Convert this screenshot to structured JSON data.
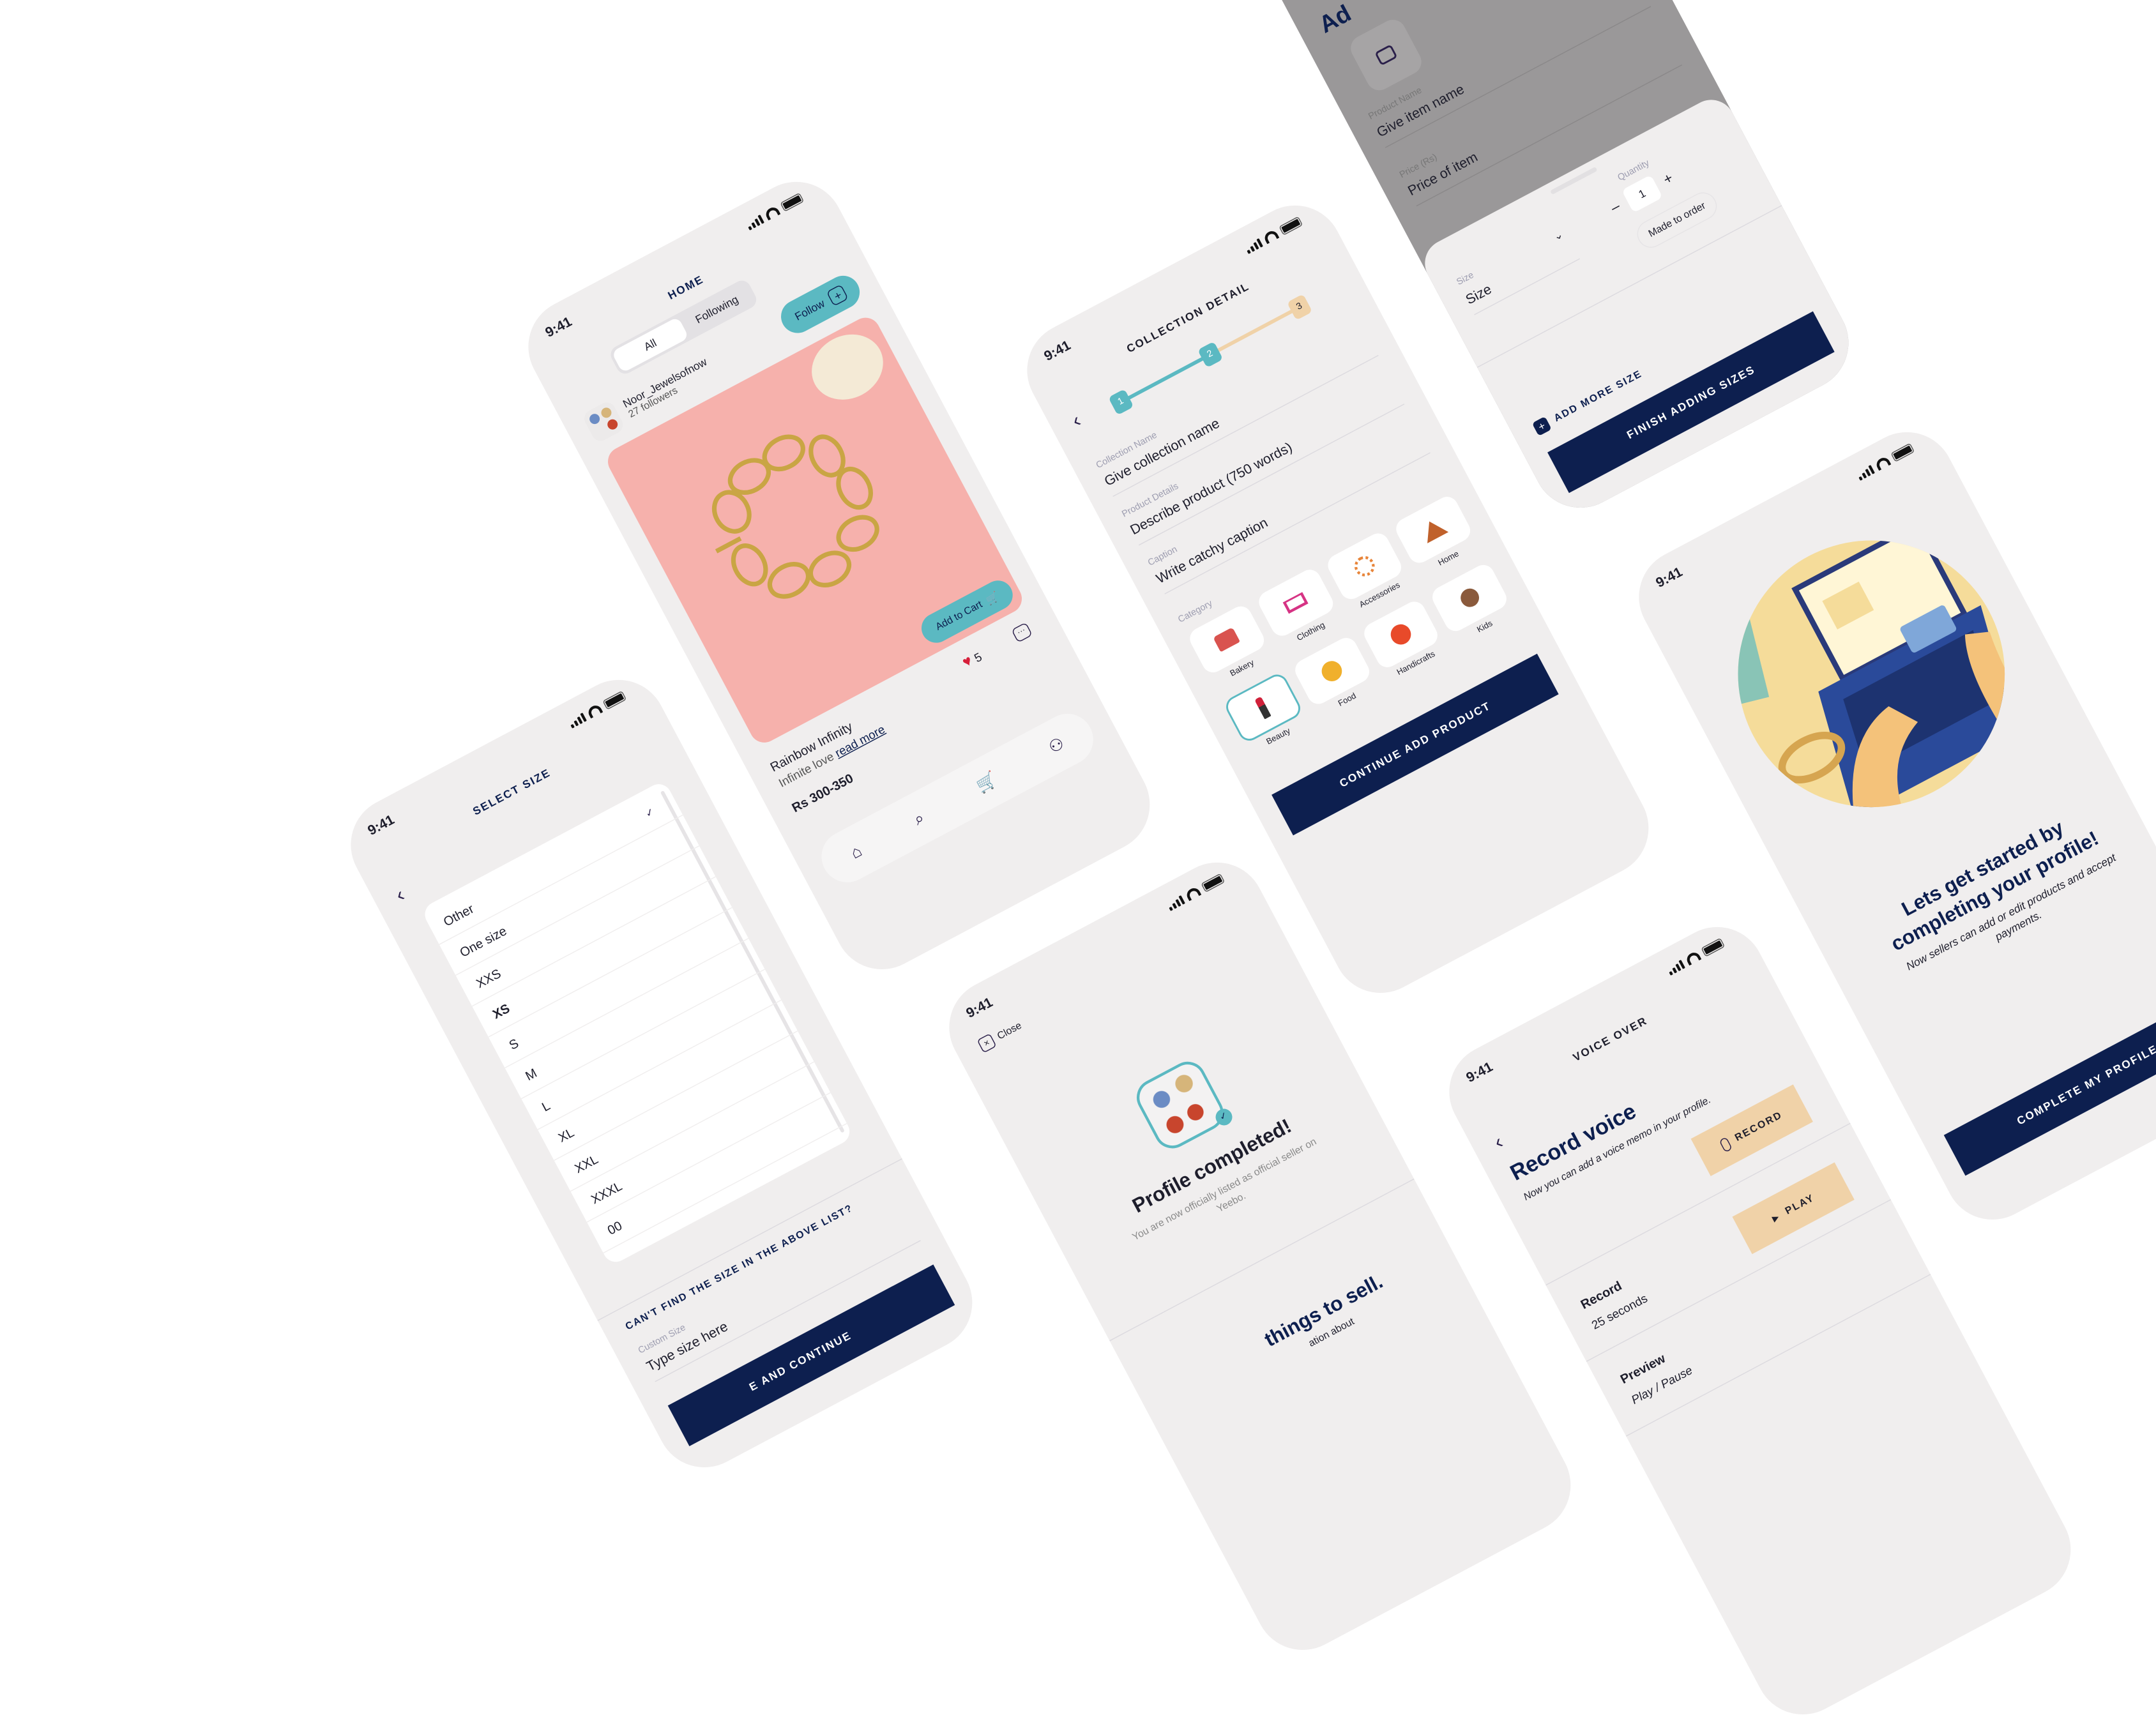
{
  "status": {
    "time": "9:41"
  },
  "colors": {
    "navy": "#0d1f4f",
    "teal": "#5bb9c2",
    "peach": "#f0d2a8",
    "screen_bg": "#f0eeee",
    "pink": "#f6b1ac"
  },
  "home": {
    "title": "HOME",
    "tabs": [
      {
        "label": "All",
        "active": true
      },
      {
        "label": "Following",
        "active": false
      }
    ],
    "follow_label": "Follow",
    "seller": {
      "name": "Noor_Jewelsofnow",
      "followers": "27 followers"
    },
    "product": {
      "name": "Rainbow Infinity",
      "desc": "Infinite love",
      "read_more": "read more",
      "price": "Rs 300-350",
      "likes": "5"
    },
    "add_to_cart": "Add to Cart",
    "nav": [
      "home-icon",
      "search-icon",
      "cart-icon",
      "profile-icon"
    ]
  },
  "collection": {
    "title": "COLLECTION DETAIL",
    "steps": [
      "1",
      "2",
      "3"
    ],
    "current_step": 2,
    "fields": [
      {
        "label": "Collection Name",
        "placeholder": "Give collection name"
      },
      {
        "label": "Product Details",
        "placeholder": "Describe product (750 words)"
      },
      {
        "label": "Caption",
        "placeholder": "Write catchy caption"
      }
    ],
    "category_label": "Category",
    "categories": [
      "Bakery",
      "Clothing",
      "Accessories",
      "Home",
      "Beauty",
      "Food",
      "Handicrafts",
      "Kids"
    ],
    "selected_category": "Beauty",
    "continue_label": "CONTINUE ADD PRODUCT"
  },
  "add_item": {
    "title": "Ad",
    "product_name_label": "Product Name",
    "product_name_placeholder": "Give item name",
    "price_label": "Price (Rs)",
    "price_placeholder": "Price of item",
    "size_label": "Size",
    "size_value": "Size",
    "quantity_label": "Quantity",
    "quantity_value": "1",
    "minus": "–",
    "plus": "+",
    "made_to_order": "Made to order",
    "add_more_size": "ADD MORE SIZE",
    "finish_label": "FINISH ADDING SIZES"
  },
  "select_size": {
    "title": "SELECT SIZE",
    "options": [
      "Other",
      "One size",
      "XXS",
      "XS",
      "S",
      "M",
      "L",
      "XL",
      "XXL",
      "XXXL",
      "00"
    ],
    "checked": "Other",
    "bold": "XS",
    "cant_find": "CAN'T FIND THE SIZE IN THE ABOVE LIST?",
    "custom_label": "Custom Size",
    "custom_placeholder": "Type size here",
    "continue_label": "E AND CONTINUE"
  },
  "profile_done": {
    "close_label": "Close",
    "heading": "Profile completed!",
    "message": "You are now officially listed as official seller on Yeebo.",
    "next_heading": "things to sell.",
    "next_text": "ation about"
  },
  "voice": {
    "title": "VOICE OVER",
    "heading": "Record voice",
    "subtitle": "Now you can add a voice memo in your profile.",
    "record_label": "RECORD",
    "record_title": "Record",
    "record_duration": "25 seconds",
    "play_label": "PLAY",
    "preview_title": "Preview",
    "preview_sub": "Play / Pause"
  },
  "onboarding": {
    "heading": "Lets get started by completing your profile!",
    "text": "Now sellers can add or edit products and accept payments.",
    "button": "COMPLETE MY PROFILE"
  }
}
